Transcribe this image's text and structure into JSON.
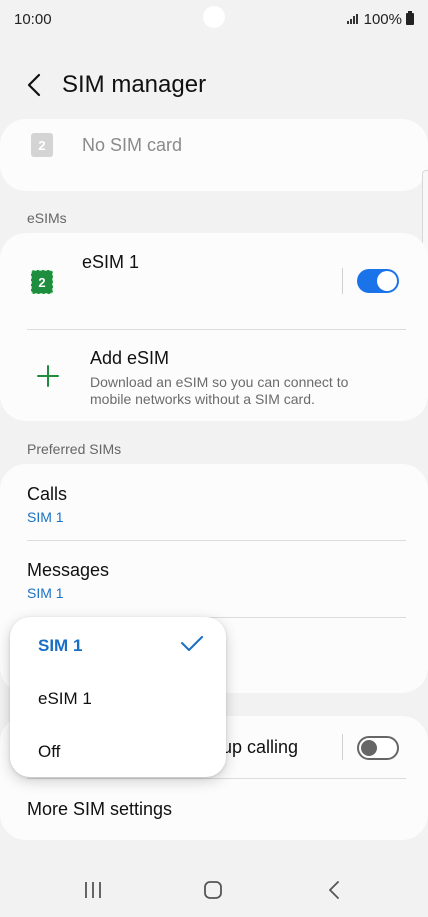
{
  "status": {
    "time": "10:00",
    "battery": "100%"
  },
  "header": {
    "title": "SIM manager"
  },
  "physical_sim": {
    "slot_number": "2",
    "label": "No SIM card"
  },
  "esims_section": {
    "label": "eSIMs",
    "esim": {
      "slot_number": "2",
      "name": "eSIM 1",
      "enabled": true
    },
    "add": {
      "title": "Add eSIM",
      "description": "Download an eSIM so you can connect to mobile networks without a SIM card."
    }
  },
  "preferred_section": {
    "label": "Preferred SIMs",
    "items": [
      {
        "title": "Calls",
        "value": "SIM 1"
      },
      {
        "title": "Messages",
        "value": "SIM 1"
      }
    ]
  },
  "backup_calling": {
    "label_visible": "kup calling",
    "enabled": false
  },
  "more": {
    "label": "More SIM settings"
  },
  "dropdown": {
    "options": [
      "SIM 1",
      "eSIM 1",
      "Off"
    ],
    "selected": "SIM 1"
  },
  "colors": {
    "accent": "#1a73e8",
    "link": "#1a73c4",
    "esim_green": "#1e8e3e"
  },
  "icons": {
    "back": "chevron-left-icon",
    "add": "plus-icon",
    "check": "check-icon",
    "nav_recents": "recents-icon",
    "nav_home": "home-icon",
    "nav_back": "back-icon"
  }
}
